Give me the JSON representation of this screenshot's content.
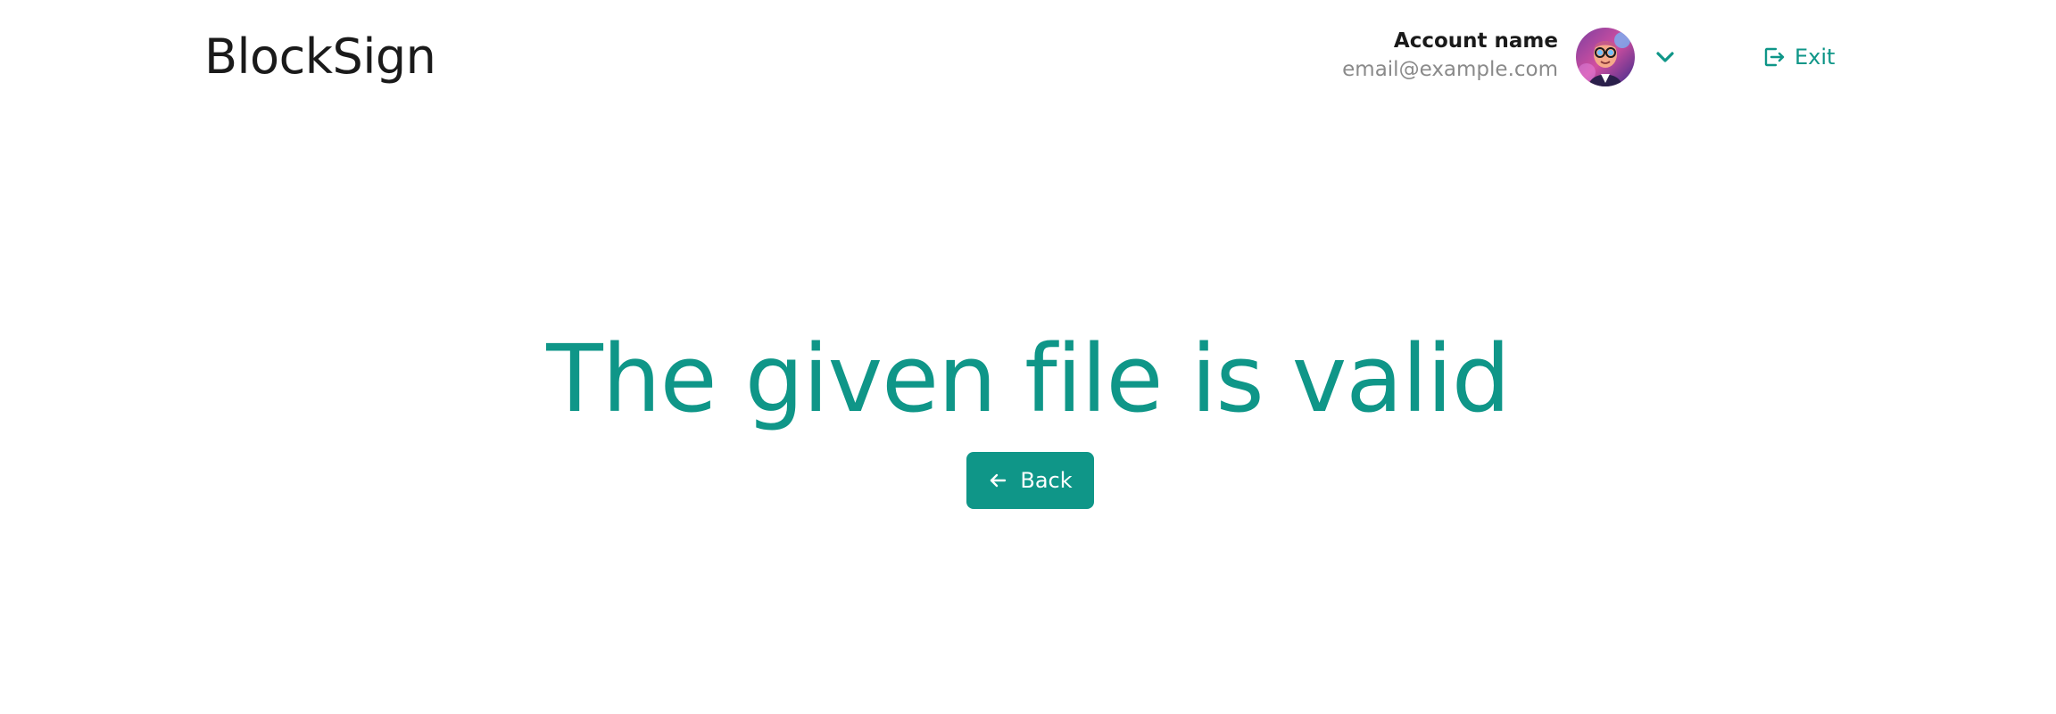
{
  "app": {
    "logo_text": "BlockSign"
  },
  "account": {
    "name": "Account name",
    "email": "email@example.com",
    "avatar_icon": "avatar-icon",
    "dropdown_icon": "chevron-down-icon"
  },
  "header": {
    "exit_label": "Exit",
    "exit_icon": "exit-icon"
  },
  "main": {
    "title": "The given file is valid",
    "back_label": "Back",
    "back_icon": "arrow-left-icon"
  },
  "colors": {
    "accent": "#0f9688",
    "text_dark": "#1a1a1a",
    "text_muted": "#8a8a8a",
    "background": "#ffffff"
  }
}
